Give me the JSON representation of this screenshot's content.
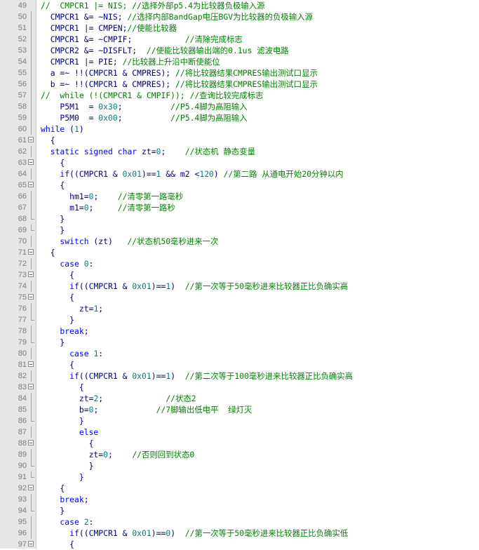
{
  "colors": {
    "keyword": "#0000ff",
    "number": "#008080",
    "comment": "#008000",
    "code": "#000080",
    "gutter": "#e6e6e6"
  },
  "lines": [
    {
      "num": "49",
      "fold": "none",
      "segments": [
        {
          "t": "c",
          "v": "//  CMPCR1 |= NIS; //选择外部p5.4为比较器负极输入源"
        }
      ]
    },
    {
      "num": "50",
      "fold": "line",
      "segments": [
        {
          "t": "d",
          "v": "  CMPCR1 &= ~NIS; "
        },
        {
          "t": "c",
          "v": "//选择内部BandGap电压BGV为比较器的负极输入源"
        }
      ]
    },
    {
      "num": "51",
      "fold": "line",
      "segments": [
        {
          "t": "d",
          "v": "  CMPCR1 |= CMPEN;"
        },
        {
          "t": "c",
          "v": "//使能比较器"
        }
      ]
    },
    {
      "num": "52",
      "fold": "line",
      "segments": [
        {
          "t": "d",
          "v": "  CMPCR1 &= ~CMPIF;           "
        },
        {
          "t": "c",
          "v": "//清除完成标志"
        }
      ]
    },
    {
      "num": "53",
      "fold": "line",
      "segments": [
        {
          "t": "d",
          "v": "  CMPCR2 &= ~DISFLT;  "
        },
        {
          "t": "c",
          "v": "//使能比较器输出端的0.1us 滤波电路"
        }
      ]
    },
    {
      "num": "54",
      "fold": "line",
      "segments": [
        {
          "t": "d",
          "v": "  CMPCR1 |= PIE; "
        },
        {
          "t": "c",
          "v": "//比较器上升沿中断使能位"
        }
      ]
    },
    {
      "num": "55",
      "fold": "line",
      "segments": [
        {
          "t": "d",
          "v": "  a =~ !!(CMPCR1 & CMPRES); "
        },
        {
          "t": "c",
          "v": "//将比较器结果CMPRES输出测试口显示"
        }
      ]
    },
    {
      "num": "56",
      "fold": "line",
      "segments": [
        {
          "t": "d",
          "v": "  b =~ !!(CMPCR1 & CMPRES); "
        },
        {
          "t": "c",
          "v": "//将比较器结果CMPRES输出测试口显示"
        }
      ]
    },
    {
      "num": "57",
      "fold": "line",
      "segments": [
        {
          "t": "c",
          "v": "//  while (!(CMPCR1 & CMPIF)); //查询比较完成标志"
        }
      ]
    },
    {
      "num": "58",
      "fold": "line",
      "segments": [
        {
          "t": "d",
          "v": "    P5M1  = "
        },
        {
          "t": "n",
          "v": "0x30"
        },
        {
          "t": "d",
          "v": ";          "
        },
        {
          "t": "c",
          "v": "//P5.4脚为高阻输入"
        }
      ]
    },
    {
      "num": "59",
      "fold": "line",
      "segments": [
        {
          "t": "d",
          "v": "    P5M0  = "
        },
        {
          "t": "n",
          "v": "0x00"
        },
        {
          "t": "d",
          "v": ";          "
        },
        {
          "t": "c",
          "v": "//P5.4脚为高阻输入"
        }
      ]
    },
    {
      "num": "60",
      "fold": "line",
      "segments": [
        {
          "t": "k",
          "v": "while"
        },
        {
          "t": "d",
          "v": " ("
        },
        {
          "t": "n",
          "v": "1"
        },
        {
          "t": "d",
          "v": ")"
        }
      ]
    },
    {
      "num": "61",
      "fold": "box",
      "segments": [
        {
          "t": "d",
          "v": "  {"
        }
      ]
    },
    {
      "num": "62",
      "fold": "line",
      "segments": [
        {
          "t": "k",
          "v": "  static signed char"
        },
        {
          "t": "d",
          "v": " zt="
        },
        {
          "t": "n",
          "v": "0"
        },
        {
          "t": "d",
          "v": ";    "
        },
        {
          "t": "c",
          "v": "//状态机 静态变量"
        }
      ]
    },
    {
      "num": "63",
      "fold": "box",
      "segments": [
        {
          "t": "d",
          "v": "    {"
        }
      ]
    },
    {
      "num": "64",
      "fold": "line",
      "segments": [
        {
          "t": "k",
          "v": "    if"
        },
        {
          "t": "d",
          "v": "((CMPCR1 & "
        },
        {
          "t": "n",
          "v": "0x01"
        },
        {
          "t": "d",
          "v": ")=="
        },
        {
          "t": "n",
          "v": "1"
        },
        {
          "t": "d",
          "v": " && m2 <"
        },
        {
          "t": "n",
          "v": "120"
        },
        {
          "t": "d",
          "v": ") "
        },
        {
          "t": "c",
          "v": "//第二路 从通电开始20分钟以内"
        }
      ]
    },
    {
      "num": "65",
      "fold": "box",
      "segments": [
        {
          "t": "d",
          "v": "    {"
        }
      ]
    },
    {
      "num": "66",
      "fold": "line",
      "segments": [
        {
          "t": "d",
          "v": "      hm1="
        },
        {
          "t": "n",
          "v": "0"
        },
        {
          "t": "d",
          "v": ";    "
        },
        {
          "t": "c",
          "v": "//清零第一路毫秒"
        }
      ]
    },
    {
      "num": "67",
      "fold": "line",
      "segments": [
        {
          "t": "d",
          "v": "      m1="
        },
        {
          "t": "n",
          "v": "0"
        },
        {
          "t": "d",
          "v": ";     "
        },
        {
          "t": "c",
          "v": "//清零第一路秒"
        }
      ]
    },
    {
      "num": "68",
      "fold": "end",
      "segments": [
        {
          "t": "d",
          "v": "    }"
        }
      ]
    },
    {
      "num": "69",
      "fold": "end",
      "segments": [
        {
          "t": "d",
          "v": "    }"
        }
      ]
    },
    {
      "num": "70",
      "fold": "line",
      "segments": [
        {
          "t": "k",
          "v": "    switch"
        },
        {
          "t": "d",
          "v": " (zt)   "
        },
        {
          "t": "c",
          "v": "//状态机50毫秒进来一次"
        }
      ]
    },
    {
      "num": "71",
      "fold": "box",
      "segments": [
        {
          "t": "d",
          "v": "  {"
        }
      ]
    },
    {
      "num": "72",
      "fold": "line",
      "segments": [
        {
          "t": "k",
          "v": "    case"
        },
        {
          "t": "d",
          "v": " "
        },
        {
          "t": "n",
          "v": "0"
        },
        {
          "t": "d",
          "v": ":"
        }
      ]
    },
    {
      "num": "73",
      "fold": "box",
      "segments": [
        {
          "t": "d",
          "v": "      {"
        }
      ]
    },
    {
      "num": "74",
      "fold": "line",
      "segments": [
        {
          "t": "k",
          "v": "      if"
        },
        {
          "t": "d",
          "v": "((CMPCR1 & "
        },
        {
          "t": "n",
          "v": "0x01"
        },
        {
          "t": "d",
          "v": ")=="
        },
        {
          "t": "n",
          "v": "1"
        },
        {
          "t": "d",
          "v": ")  "
        },
        {
          "t": "c",
          "v": "//第一次等于50毫秒进来比较器正比负确实高"
        }
      ]
    },
    {
      "num": "75",
      "fold": "box",
      "segments": [
        {
          "t": "d",
          "v": "      {"
        }
      ]
    },
    {
      "num": "76",
      "fold": "line",
      "segments": [
        {
          "t": "d",
          "v": "        zt="
        },
        {
          "t": "n",
          "v": "1"
        },
        {
          "t": "d",
          "v": ";"
        }
      ]
    },
    {
      "num": "77",
      "fold": "end",
      "segments": [
        {
          "t": "d",
          "v": "      }"
        }
      ]
    },
    {
      "num": "78",
      "fold": "line",
      "segments": [
        {
          "t": "k",
          "v": "    break"
        },
        {
          "t": "d",
          "v": ";"
        }
      ]
    },
    {
      "num": "79",
      "fold": "end",
      "segments": [
        {
          "t": "d",
          "v": "    }"
        }
      ]
    },
    {
      "num": "80",
      "fold": "line",
      "segments": [
        {
          "t": "k",
          "v": "      case"
        },
        {
          "t": "d",
          "v": " "
        },
        {
          "t": "n",
          "v": "1"
        },
        {
          "t": "d",
          "v": ":"
        }
      ]
    },
    {
      "num": "81",
      "fold": "box",
      "segments": [
        {
          "t": "d",
          "v": "      {"
        }
      ]
    },
    {
      "num": "82",
      "fold": "line",
      "segments": [
        {
          "t": "k",
          "v": "      if"
        },
        {
          "t": "d",
          "v": "((CMPCR1 & "
        },
        {
          "t": "n",
          "v": "0x01"
        },
        {
          "t": "d",
          "v": ")=="
        },
        {
          "t": "n",
          "v": "1"
        },
        {
          "t": "d",
          "v": ")  "
        },
        {
          "t": "c",
          "v": "//第二次等于100毫秒进来比较器正比负确实高"
        }
      ]
    },
    {
      "num": "83",
      "fold": "box",
      "segments": [
        {
          "t": "d",
          "v": "        {"
        }
      ]
    },
    {
      "num": "84",
      "fold": "line",
      "segments": [
        {
          "t": "d",
          "v": "        zt="
        },
        {
          "t": "n",
          "v": "2"
        },
        {
          "t": "d",
          "v": ";             "
        },
        {
          "t": "c",
          "v": "//状态2"
        }
      ]
    },
    {
      "num": "85",
      "fold": "line",
      "segments": [
        {
          "t": "d",
          "v": "        b="
        },
        {
          "t": "n",
          "v": "0"
        },
        {
          "t": "d",
          "v": ";            "
        },
        {
          "t": "c",
          "v": "//7脚输出低电平  绿灯灭"
        }
      ]
    },
    {
      "num": "86",
      "fold": "end",
      "segments": [
        {
          "t": "d",
          "v": "        }"
        }
      ]
    },
    {
      "num": "87",
      "fold": "line",
      "segments": [
        {
          "t": "k",
          "v": "        else"
        }
      ]
    },
    {
      "num": "88",
      "fold": "box",
      "segments": [
        {
          "t": "d",
          "v": "          {"
        }
      ]
    },
    {
      "num": "89",
      "fold": "line",
      "segments": [
        {
          "t": "d",
          "v": "          zt="
        },
        {
          "t": "n",
          "v": "0"
        },
        {
          "t": "d",
          "v": ";    "
        },
        {
          "t": "c",
          "v": "//否则回到状态0"
        }
      ]
    },
    {
      "num": "90",
      "fold": "end",
      "segments": [
        {
          "t": "d",
          "v": "          }"
        }
      ]
    },
    {
      "num": "91",
      "fold": "end",
      "segments": [
        {
          "t": "d",
          "v": "        }"
        }
      ]
    },
    {
      "num": "92",
      "fold": "box",
      "segments": [
        {
          "t": "d",
          "v": "    {"
        }
      ]
    },
    {
      "num": "93",
      "fold": "line",
      "segments": [
        {
          "t": "k",
          "v": "    break"
        },
        {
          "t": "d",
          "v": ";"
        }
      ]
    },
    {
      "num": "94",
      "fold": "end",
      "segments": [
        {
          "t": "d",
          "v": "    }"
        }
      ]
    },
    {
      "num": "95",
      "fold": "line",
      "segments": [
        {
          "t": "k",
          "v": "    case"
        },
        {
          "t": "d",
          "v": " "
        },
        {
          "t": "n",
          "v": "2"
        },
        {
          "t": "d",
          "v": ":"
        }
      ]
    },
    {
      "num": "96",
      "fold": "line",
      "segments": [
        {
          "t": "k",
          "v": "      if"
        },
        {
          "t": "d",
          "v": "((CMPCR1 & "
        },
        {
          "t": "n",
          "v": "0x01"
        },
        {
          "t": "d",
          "v": ")=="
        },
        {
          "t": "n",
          "v": "0"
        },
        {
          "t": "d",
          "v": ")  "
        },
        {
          "t": "c",
          "v": "//第一次等于50毫秒进来比较器正比负确实低"
        }
      ]
    },
    {
      "num": "97",
      "fold": "box",
      "segments": [
        {
          "t": "d",
          "v": "      {"
        }
      ]
    }
  ]
}
